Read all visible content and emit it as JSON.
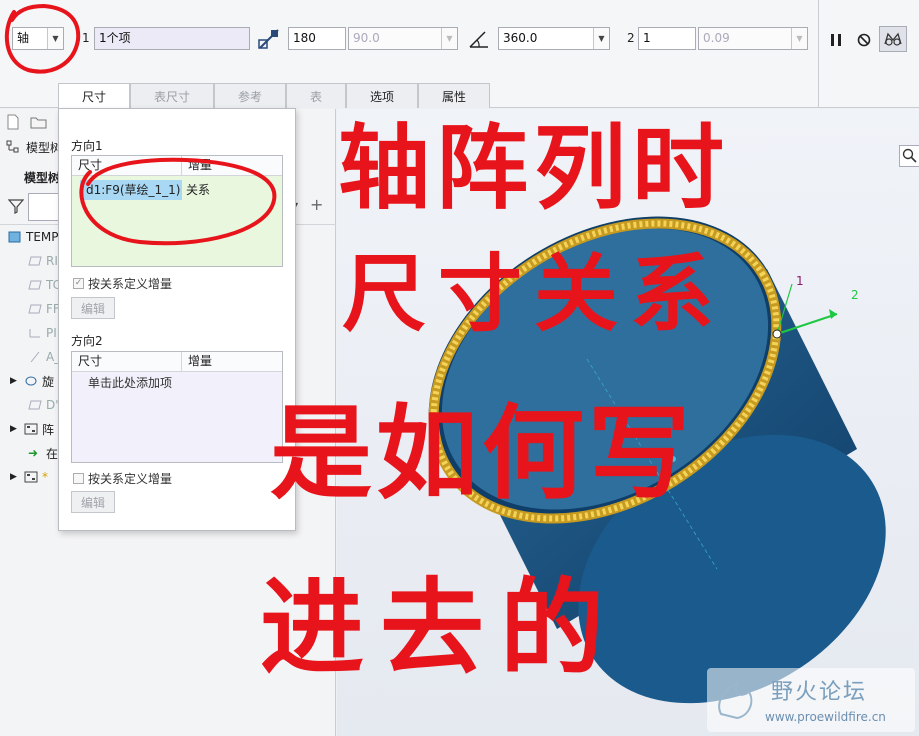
{
  "dashboard": {
    "type_select": "轴",
    "dir1_number": "1",
    "dir1_items": "1个项",
    "member_count": "180",
    "member_spacing": "90.0",
    "angle_extent": "360.0",
    "dir2_number": "2",
    "dir2_count": "1",
    "dir2_spacing": "0.09"
  },
  "tabs": [
    "尺寸",
    "表尺寸",
    "参考",
    "表",
    "选项",
    "属性"
  ],
  "left_panel": {
    "model_tree_label": "模型树",
    "model_tree_title": "模型树",
    "tree_rows": [
      "TEMP",
      "RI",
      "TC",
      "FF",
      "PI",
      "A_",
      "旋",
      "D'",
      "阵",
      "在",
      "*"
    ]
  },
  "popup": {
    "dir1_title": "方向1",
    "col_dim": "尺寸",
    "col_inc": "增量",
    "row1_dim": "d1:F9(草绘_1_1)",
    "row1_inc": "关系",
    "relation_check_label": "按关系定义增量",
    "edit_button": "编辑",
    "dir2_title": "方向2",
    "add_item_hint": "单击此处添加项",
    "relation_check_label2": "按关系定义增量",
    "edit_button2": "编辑"
  },
  "annotation": {
    "line1": "轴阵列时",
    "line2": "尺寸关系",
    "line3": "是如何写",
    "line4": "进去的"
  },
  "axis_labels": {
    "a1": "1",
    "a2": "2"
  },
  "watermark": {
    "brand": "野火论坛",
    "url": "www.proewildfire.cn"
  },
  "colors": {
    "cylinder": "#1f5d8c",
    "ring": "#e8c23a",
    "annotation": "#e8141b",
    "accent": "#1ec842"
  }
}
